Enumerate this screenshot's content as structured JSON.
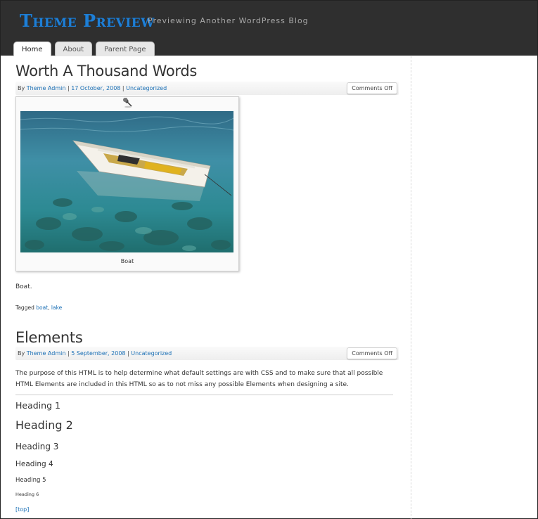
{
  "site": {
    "title": "Theme Preview",
    "tagline": "Previewing Another WordPress Blog"
  },
  "nav": {
    "tabs": [
      {
        "label": "Home",
        "active": true
      },
      {
        "label": "About",
        "active": false
      },
      {
        "label": "Parent Page",
        "active": false
      }
    ]
  },
  "posts": [
    {
      "title": "Worth A Thousand Words",
      "meta_by": "By",
      "author": "Theme Admin",
      "date": "17 October, 2008",
      "category": "Uncategorized",
      "comments": "Comments Off",
      "image_caption": "Boat",
      "body": "Boat.",
      "tagged_label": "Tagged",
      "tags": [
        "boat",
        "lake"
      ]
    },
    {
      "title": "Elements",
      "meta_by": "By",
      "author": "Theme Admin",
      "date": "5 September, 2008",
      "category": "Uncategorized",
      "comments": "Comments Off",
      "body": "The purpose of this HTML is to help determine what default settings are with CSS and to make sure that all possible HTML Elements are included in this HTML so as to not miss any possible Elements when designing a site.",
      "headings": [
        "Heading 1",
        "Heading 2",
        "Heading 3",
        "Heading 4",
        "Heading 5",
        "Heading 6"
      ],
      "top_link": "[top]"
    }
  ],
  "colors": {
    "header_bg": "#2f2f2f",
    "title_blue": "#1e7fd6",
    "link_blue": "#1a6fb5"
  },
  "icons": {
    "pin": "pushpin-icon"
  }
}
